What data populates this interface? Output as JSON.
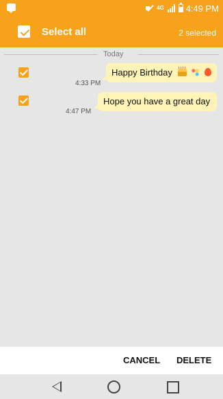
{
  "status_bar": {
    "time": "4:49 PM",
    "network_label": "4G",
    "icons": [
      "message-notification-icon",
      "mute-icon",
      "4g-icon",
      "signal-icon",
      "battery-icon"
    ]
  },
  "action_bar": {
    "select_all_label": "Select all",
    "selected_count": "2 selected"
  },
  "conversation": {
    "date_label": "Today",
    "messages": [
      {
        "time": "4:33 PM",
        "text": "Happy Birthday",
        "selected": true
      },
      {
        "time": "4:47 PM",
        "text": "Hope you have a great day",
        "selected": true
      }
    ]
  },
  "bottom_actions": {
    "cancel_label": "CANCEL",
    "delete_label": "DELETE"
  },
  "nav_bar": {
    "icons": [
      "back-icon",
      "home-icon",
      "recent-apps-icon"
    ]
  }
}
